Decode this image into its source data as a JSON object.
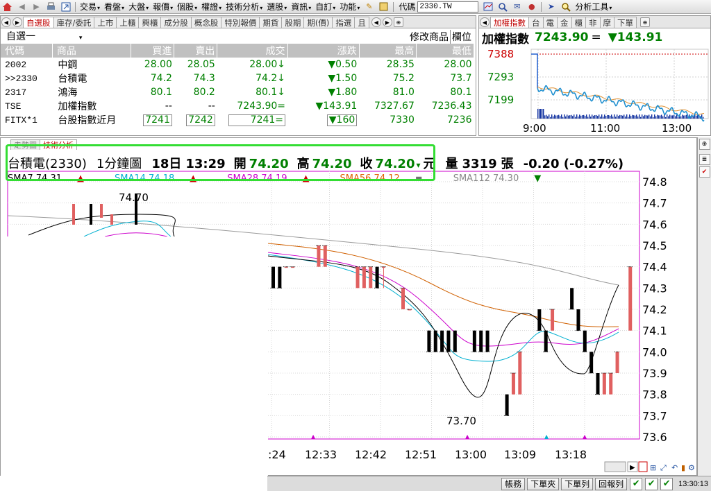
{
  "menubar": {
    "items": [
      "交易",
      "看盤",
      "大盤",
      "報價",
      "個股",
      "權證",
      "技術分析",
      "選股",
      "資訊",
      "自訂",
      "功能"
    ],
    "code_label": "代碼",
    "code_value": "2330.TW",
    "tools_label": "分析工具"
  },
  "quote_panel": {
    "tabs": [
      "自選股",
      "庫存/委託",
      "上市",
      "上櫃",
      "興櫃",
      "成分股",
      "概念股",
      "特別報價",
      "期貨",
      "股期",
      "期(價)",
      "指選",
      "且"
    ],
    "active_tab": "自選股",
    "watchlist_name": "自選一",
    "actions": [
      "修改商品",
      "欄位"
    ],
    "columns": [
      "代碼",
      "商品",
      "買進",
      "賣出",
      "成交",
      "漲跌",
      "最高",
      "最低"
    ],
    "rows": [
      {
        "code": "2002",
        "name": "中鋼",
        "bid": "28.00",
        "ask": "28.05",
        "last": "28.00↓",
        "chg": "▼0.50",
        "high": "28.35",
        "low": "28.00"
      },
      {
        "code": ">>2330",
        "name": "台積電",
        "bid": "74.2",
        "ask": "74.3",
        "last": "74.2↓",
        "chg": "▼1.50",
        "high": "75.2",
        "low": "73.7"
      },
      {
        "code": "2317",
        "name": "鴻海",
        "bid": "80.1",
        "ask": "80.2",
        "last": "80.1↓",
        "chg": "▼1.80",
        "high": "81.0",
        "low": "80.1"
      },
      {
        "code": "TSE",
        "name": "加權指數",
        "bid": "--",
        "ask": "--",
        "last": "7243.90=",
        "chg": "▼143.91",
        "high": "7327.67",
        "low": "7236.43"
      },
      {
        "code": "FITX*1",
        "name": "台股指數近月",
        "bid": "7241",
        "ask": "7242",
        "last": "7241=",
        "chg": "▼160",
        "high": "7330",
        "low": "7236"
      }
    ]
  },
  "index_panel": {
    "tabs": [
      "加權指數",
      "台",
      "電",
      "金",
      "櫃",
      "非",
      "摩",
      "下單"
    ],
    "active_tab": "加權指數",
    "title": "加權指數",
    "value": "7243.90",
    "eq": "=",
    "change": "▼143.91",
    "y_ticks": [
      "7388",
      "7293",
      "7199"
    ],
    "x_ticks": [
      "9:00",
      "11:00",
      "13:00"
    ]
  },
  "chart_panel": {
    "tabs": [
      "走勢圖",
      "技術分析"
    ],
    "active_tab": "技術分析",
    "title_parts": {
      "stock": "台積電(2330)",
      "period": "1分鐘圖",
      "date": "18日",
      "time": "13:29",
      "open_label": "開",
      "open": "74.20",
      "high_label": "高",
      "high": "74.20",
      "close_label": "收",
      "close": "74.20",
      "arrow": "▾",
      "unit": "元",
      "volume_label": "量",
      "volume": "3319",
      "volume_unit": "張",
      "change": "-0.20 (-0.27%)"
    },
    "sma_legend": [
      {
        "text": "SMA7 74.31",
        "arrow": "▲",
        "color": "#000000",
        "arrow_color": "#cc0000"
      },
      {
        "text": "SMA14 74.18",
        "arrow": "▲",
        "color": "#00b0d0",
        "arrow_color": "#cc0000"
      },
      {
        "text": "SMA28 74.19",
        "arrow": "▲",
        "color": "#cc00cc",
        "arrow_color": "#cc0000"
      },
      {
        "text": "SMA56 74.12",
        "arrow": "=",
        "color": "#e06000",
        "arrow_color": "#000000"
      },
      {
        "text": "SMA112 74.30",
        "arrow": "▼",
        "color": "#888888",
        "arrow_color": "#008000"
      }
    ],
    "y_ticks": [
      "74.8",
      "74.7",
      "74.6",
      "74.5",
      "74.4",
      "74.3",
      "74.2",
      "74.1",
      "74.0",
      "73.9",
      "73.8",
      "73.7",
      "73.6"
    ],
    "x_ticks": [
      ":24",
      "12:33",
      "12:42",
      "12:51",
      "13:00",
      "13:09",
      "13:18"
    ],
    "annotations": {
      "high": "74.70",
      "low": "73.70"
    }
  },
  "statusbar": {
    "buttons": [
      "帳務",
      "下單夾",
      "下單列",
      "回報列"
    ],
    "clock": "13:30:13"
  },
  "chart_data": {
    "type": "candlestick",
    "ylim": [
      73.6,
      74.8
    ],
    "x_tick_labels": [
      ":24",
      "12:33",
      "12:42",
      "12:51",
      "13:00",
      "13:09",
      "13:18"
    ],
    "candles_visible": [
      {
        "x": 0,
        "o": 74.4,
        "c": 74.3,
        "h": 74.4,
        "l": 74.3
      },
      {
        "x": 1,
        "o": 74.4,
        "c": 74.3,
        "h": 74.4,
        "l": 74.3
      },
      {
        "x": 2,
        "o": 74.4,
        "c": 74.4,
        "h": 74.4,
        "l": 74.4
      },
      {
        "x": 3,
        "o": 74.4,
        "c": 74.4,
        "h": 74.4,
        "l": 74.4
      },
      {
        "x": 7,
        "o": 74.4,
        "c": 74.5,
        "h": 74.5,
        "l": 74.4
      },
      {
        "x": 8,
        "o": 74.4,
        "c": 74.5,
        "h": 74.5,
        "l": 74.4
      },
      {
        "x": 13,
        "o": 74.3,
        "c": 74.4,
        "h": 74.4,
        "l": 74.3
      },
      {
        "x": 14,
        "o": 74.3,
        "c": 74.4,
        "h": 74.4,
        "l": 74.3
      },
      {
        "x": 15,
        "o": 74.3,
        "c": 74.4,
        "h": 74.4,
        "l": 74.3
      },
      {
        "x": 16,
        "o": 74.4,
        "c": 74.3,
        "h": 74.4,
        "l": 74.3
      },
      {
        "x": 17,
        "o": 74.4,
        "c": 74.4,
        "h": 74.4,
        "l": 74.3
      },
      {
        "x": 20,
        "o": 74.2,
        "c": 74.3,
        "h": 74.3,
        "l": 74.2
      },
      {
        "x": 21,
        "o": 74.2,
        "c": 74.2,
        "h": 74.2,
        "l": 74.2
      },
      {
        "x": 24,
        "o": 74.1,
        "c": 74.0,
        "h": 74.1,
        "l": 74.0
      },
      {
        "x": 25,
        "o": 74.1,
        "c": 74.0,
        "h": 74.1,
        "l": 74.0
      },
      {
        "x": 26,
        "o": 74.1,
        "c": 74.0,
        "h": 74.1,
        "l": 74.0
      },
      {
        "x": 27,
        "o": 74.1,
        "c": 74.0,
        "h": 74.1,
        "l": 74.0
      },
      {
        "x": 28,
        "o": 74.1,
        "c": 74.0,
        "h": 74.1,
        "l": 74.0
      },
      {
        "x": 31,
        "o": 74.1,
        "c": 74.0,
        "h": 74.1,
        "l": 74.0
      },
      {
        "x": 32,
        "o": 74.1,
        "c": 74.0,
        "h": 74.1,
        "l": 74.0
      },
      {
        "x": 33,
        "o": 74.1,
        "c": 74.0,
        "h": 74.1,
        "l": 74.0
      },
      {
        "x": 36,
        "o": 73.8,
        "c": 73.7,
        "h": 73.8,
        "l": 73.7
      },
      {
        "x": 37,
        "o": 73.8,
        "c": 73.9,
        "h": 73.9,
        "l": 73.8
      },
      {
        "x": 38,
        "o": 73.8,
        "c": 74.0,
        "h": 74.0,
        "l": 73.8
      },
      {
        "x": 41,
        "o": 74.2,
        "c": 74.1,
        "h": 74.2,
        "l": 74.1
      },
      {
        "x": 42,
        "o": 74.1,
        "c": 74.0,
        "h": 74.1,
        "l": 74.0
      },
      {
        "x": 43,
        "o": 74.1,
        "c": 74.2,
        "h": 74.2,
        "l": 74.1
      },
      {
        "x": 46,
        "o": 74.3,
        "c": 74.2,
        "h": 74.3,
        "l": 74.2
      },
      {
        "x": 47,
        "o": 74.2,
        "c": 74.1,
        "h": 74.2,
        "l": 74.1
      },
      {
        "x": 48,
        "o": 74.1,
        "c": 74.0,
        "h": 74.1,
        "l": 74.0
      },
      {
        "x": 49,
        "o": 74.0,
        "c": 73.9,
        "h": 74.0,
        "l": 73.9
      },
      {
        "x": 50,
        "o": 73.9,
        "c": 73.8,
        "h": 73.9,
        "l": 73.8
      },
      {
        "x": 51,
        "o": 73.8,
        "c": 73.9,
        "h": 73.9,
        "l": 73.8
      },
      {
        "x": 52,
        "o": 73.8,
        "c": 73.9,
        "h": 73.9,
        "l": 73.8
      },
      {
        "x": 53,
        "o": 73.9,
        "c": 74.0,
        "h": 74.0,
        "l": 73.9
      },
      {
        "x": 55,
        "o": 74.1,
        "c": 74.4,
        "h": 74.4,
        "l": 74.1
      }
    ]
  }
}
